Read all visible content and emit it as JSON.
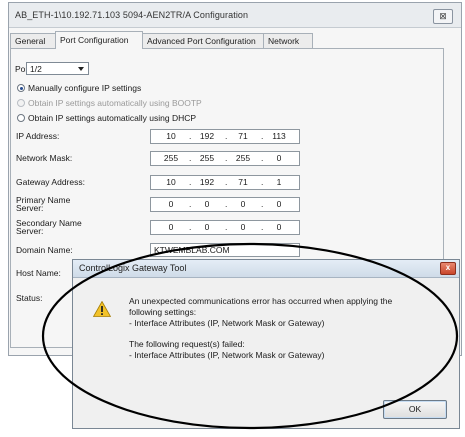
{
  "window": {
    "title": "AB_ETH-1\\10.192.71.103 5094-AEN2TR/A Configuration",
    "close_label": "⊠"
  },
  "tabs": [
    {
      "label": "General",
      "active": false
    },
    {
      "label": "Port Configuration",
      "active": true
    },
    {
      "label": "Advanced Port Configuration",
      "active": false
    },
    {
      "label": "Network",
      "active": false
    }
  ],
  "port": {
    "label": "Port:",
    "value": "1/2"
  },
  "ip_mode": {
    "manual": "Manually configure IP settings",
    "bootp": "Obtain IP settings automatically using BOOTP",
    "dhcp": "Obtain IP settings automatically using DHCP",
    "selected": "manual"
  },
  "fields": {
    "ip_address": {
      "label": "IP Address:",
      "octets": [
        "10",
        "192",
        "71",
        "113"
      ]
    },
    "network_mask": {
      "label": "Network Mask:",
      "octets": [
        "255",
        "255",
        "255",
        "0"
      ]
    },
    "gateway": {
      "label": "Gateway Address:",
      "octets": [
        "10",
        "192",
        "71",
        "1"
      ]
    },
    "primary_dns": {
      "label_line1": "Primary Name",
      "label_line2": "Server:",
      "octets": [
        "0",
        "0",
        "0",
        "0"
      ]
    },
    "secondary_dns": {
      "label_line1": "Secondary Name",
      "label_line2": "Server:",
      "octets": [
        "0",
        "0",
        "0",
        "0"
      ]
    },
    "domain_name": {
      "label": "Domain Name:",
      "value": "KTWEMBLAB.COM"
    },
    "host_name": {
      "label": "Host Name:"
    },
    "status": {
      "label": "Status:"
    }
  },
  "dialog": {
    "title": "ControlLogix Gateway Tool",
    "close_label": "x",
    "line1": "An unexpected communications error has occurred when applying the",
    "line2": "following settings:",
    "line3": "- Interface Attributes (IP, Network Mask or Gateway)",
    "line4": "The following request(s) failed:",
    "line5": "- Interface Attributes (IP, Network Mask or Gateway)",
    "ok_label": "OK"
  },
  "colors": {
    "annotation_ellipse": "#000000",
    "warning": "#f2c229"
  }
}
